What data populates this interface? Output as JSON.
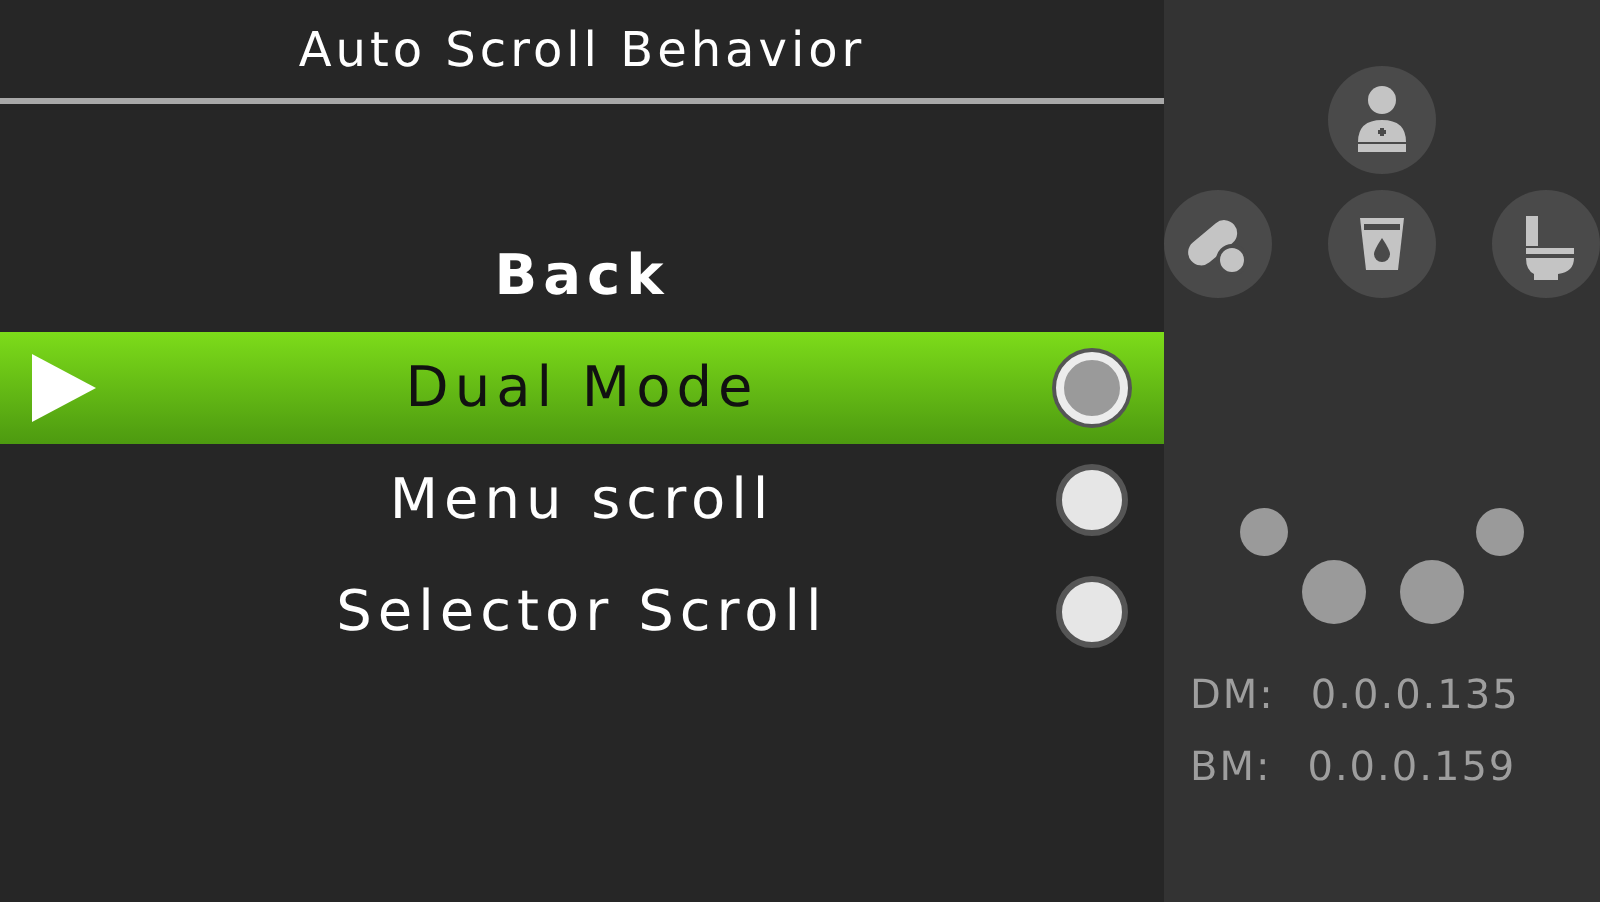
{
  "title": "Auto Scroll Behavior",
  "back": "Back",
  "options": [
    {
      "label": "Dual Mode",
      "highlighted": true,
      "selected": true
    },
    {
      "label": "Menu scroll",
      "highlighted": false,
      "selected": false
    },
    {
      "label": "Selector Scroll",
      "highlighted": false,
      "selected": false
    }
  ],
  "versions": [
    {
      "label": "DM:",
      "value": "0.0.0.135"
    },
    {
      "label": "BM:",
      "value": "0.0.0.159"
    }
  ]
}
